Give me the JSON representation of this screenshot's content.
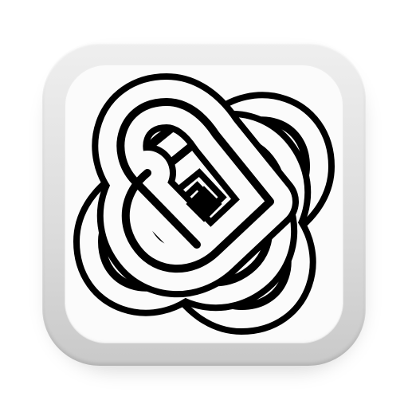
{
  "icon": {
    "semantic_name": "celtic-knot-icon",
    "colors": {
      "frame_top": "#efefef",
      "frame_bottom": "#c9c9c9",
      "face": "#fbfbfb",
      "glyph": "#000000"
    }
  }
}
